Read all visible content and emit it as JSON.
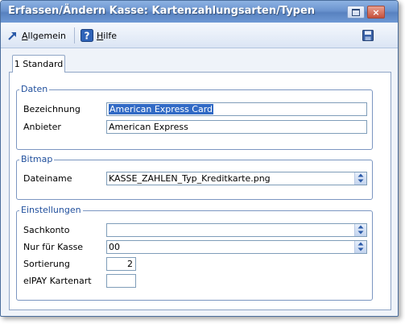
{
  "window": {
    "title": "Erfassen/Ändern Kasse: Kartenzahlungsarten/Typen",
    "close_glyph": "×"
  },
  "toolbar": {
    "allgemein": {
      "accel": "A",
      "rest": "llgemein"
    },
    "hilfe": {
      "accel": "H",
      "rest": "ilfe"
    },
    "icons": [
      "arrow-icon",
      "help-icon",
      "save-icon"
    ]
  },
  "tabs": [
    {
      "label": "1 Standard"
    }
  ],
  "daten": {
    "title": "Daten",
    "bezeichnung_label": "Bezeichnung",
    "bezeichnung_value": "American Express Card",
    "anbieter_label": "Anbieter",
    "anbieter_value": "American Express"
  },
  "bitmap": {
    "title": "Bitmap",
    "dateiname_label": "Dateiname",
    "dateiname_value": "KASSE_ZAHLEN_Typ_Kreditkarte.png"
  },
  "einstellungen": {
    "title": "Einstellungen",
    "sachkonto_label": "Sachkonto",
    "sachkonto_value": "",
    "nur_fuer_kasse_label": "Nur für Kasse",
    "nur_fuer_kasse_value": "00",
    "sortierung_label": "Sortierung",
    "sortierung_value": "2",
    "elpay_label": "elPAY Kartenart",
    "elpay_value": ""
  },
  "colors": {
    "titlebar": "#6b94cf",
    "group_title": "#1f4e9c",
    "selection": "#316ac5"
  }
}
